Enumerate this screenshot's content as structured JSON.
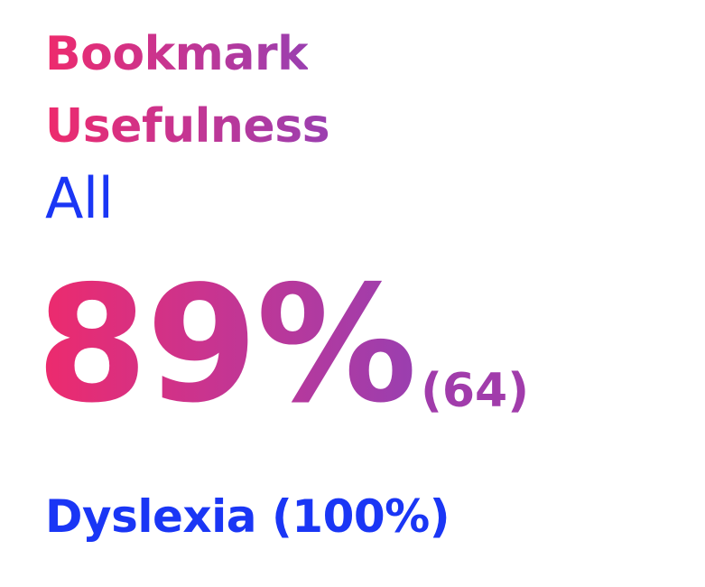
{
  "card": {
    "title_line1": "Bookmark",
    "title_line2": "Usefulness",
    "segment": "All",
    "value": "89%",
    "count": "(64)",
    "subgroup": "Dyslexia (100%)"
  },
  "colors": {
    "gradient_start": "#ee2a6c",
    "gradient_end": "#9a3fb0",
    "accent_blue": "#1a36f5",
    "background": "#ffffff"
  }
}
